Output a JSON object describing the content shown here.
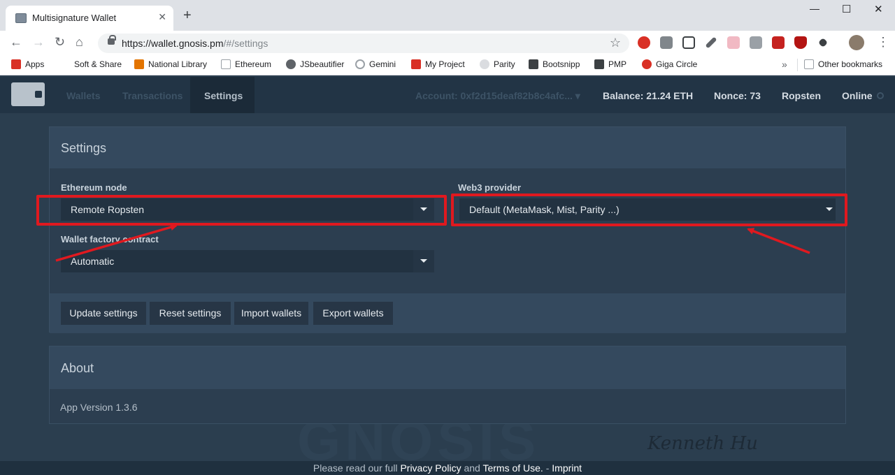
{
  "browser": {
    "tab_title": "Multisignature Wallet",
    "tab_close": "✕",
    "new_tab": "+",
    "url_host": "https://wallet.gnosis.pm",
    "url_path": "/#/settings",
    "window_controls": {
      "minimize": "—",
      "maximize": "☐",
      "close": "✕"
    },
    "nav": {
      "back": "←",
      "forward": "→",
      "reload": "↻",
      "home": "⌂",
      "star": "☆",
      "menu": "⋮"
    },
    "bookmarks": [
      {
        "label": "Apps",
        "icon": "apps-grid-icon",
        "color": "#d93025"
      },
      {
        "label": "Soft & Share",
        "icon": "",
        "color": ""
      },
      {
        "label": "National Library",
        "icon": "library-icon",
        "color": "#e37400"
      },
      {
        "label": "Ethereum",
        "icon": "document-icon",
        "color": "#9aa0a6"
      },
      {
        "label": "JSbeautifier",
        "icon": "owl-icon",
        "color": "#5f6368"
      },
      {
        "label": "Gemini",
        "icon": "gemini-icon",
        "color": "#9aa0a6"
      },
      {
        "label": "My Project",
        "icon": "project-icon",
        "color": "#d93025"
      },
      {
        "label": "Parity",
        "icon": "parity-icon",
        "color": "#9aa0a6"
      },
      {
        "label": "Bootsnipp",
        "icon": "bootsnipp-icon",
        "color": "#3c4043"
      },
      {
        "label": "PMP",
        "icon": "pmp-icon",
        "color": "#3c4043"
      },
      {
        "label": "Giga Circle",
        "icon": "giga-circle-icon",
        "color": "#d93025"
      }
    ],
    "bookmarks_more": "»",
    "other_bookmarks": "Other bookmarks"
  },
  "navbar": {
    "items": [
      "Wallets",
      "Transactions",
      "Settings"
    ],
    "active": "Settings",
    "account": "Account: 0xf2d15deaf82b8c4afc...",
    "account_caret": "▾",
    "balance": "Balance: 21.24 ETH",
    "nonce": "Nonce: 73",
    "network": "Ropsten",
    "status": "Online"
  },
  "settings": {
    "title": "Settings",
    "ethereum_node_label": "Ethereum node",
    "ethereum_node_value": "Remote Ropsten",
    "web3_provider_label": "Web3 provider",
    "web3_provider_value": "Default (MetaMask, Mist, Parity ...)",
    "wallet_factory_label": "Wallet factory contract",
    "wallet_factory_value": "Automatic",
    "buttons": {
      "update": "Update settings",
      "reset": "Reset settings",
      "import": "Import wallets",
      "export": "Export wallets"
    }
  },
  "about": {
    "title": "About",
    "app_version": "App Version 1.3.6"
  },
  "footer": {
    "prefix": "Please read our full",
    "privacy": "Privacy Policy",
    "and": "and",
    "terms": "Terms of Use.",
    "dash": "-",
    "imprint": "Imprint"
  },
  "watermark": "GNOSIS",
  "signature": "Kenneth Hu",
  "colors": {
    "annotation_red": "#e0191f",
    "page_background": "#2b3e4f",
    "navbar": "#223445"
  }
}
